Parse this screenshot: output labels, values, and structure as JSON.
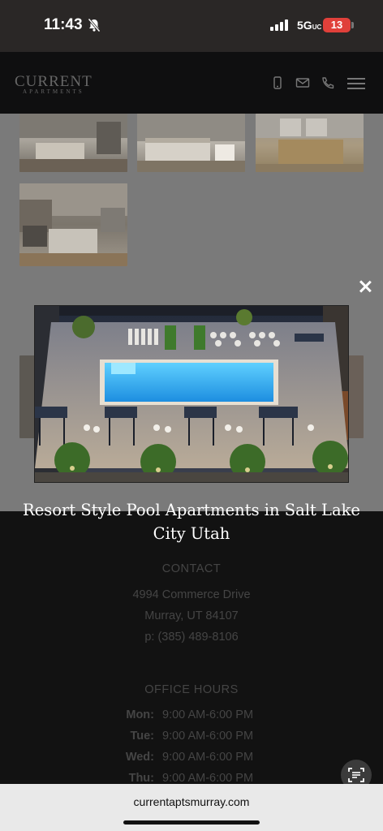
{
  "status_bar": {
    "time": "11:43",
    "network": "5G",
    "network_suffix": "UC",
    "battery": "13"
  },
  "header": {
    "logo_main": "CURRENT",
    "logo_sub": "APARTMENTS",
    "icons": [
      "mobile-icon",
      "mail-icon",
      "phone-icon",
      "menu-icon"
    ]
  },
  "lightbox": {
    "caption": "Resort Style Pool Apartments in Salt Lake City Utah"
  },
  "contact": {
    "title": "CONTACT",
    "address_line1": "4994 Commerce Drive",
    "address_line2": "Murray, UT 84107",
    "phone": "p: (385) 489-8106"
  },
  "office_hours": {
    "title": "OFFICE HOURS",
    "rows": [
      {
        "day": "Mon:",
        "hours": "9:00 AM-6:00 PM"
      },
      {
        "day": "Tue:",
        "hours": "9:00 AM-6:00 PM"
      },
      {
        "day": "Wed:",
        "hours": "9:00 AM-6:00 PM"
      },
      {
        "day": "Thu:",
        "hours": "9:00 AM-6:00 PM"
      }
    ]
  },
  "browser": {
    "url": "currentaptsmurray.com"
  }
}
